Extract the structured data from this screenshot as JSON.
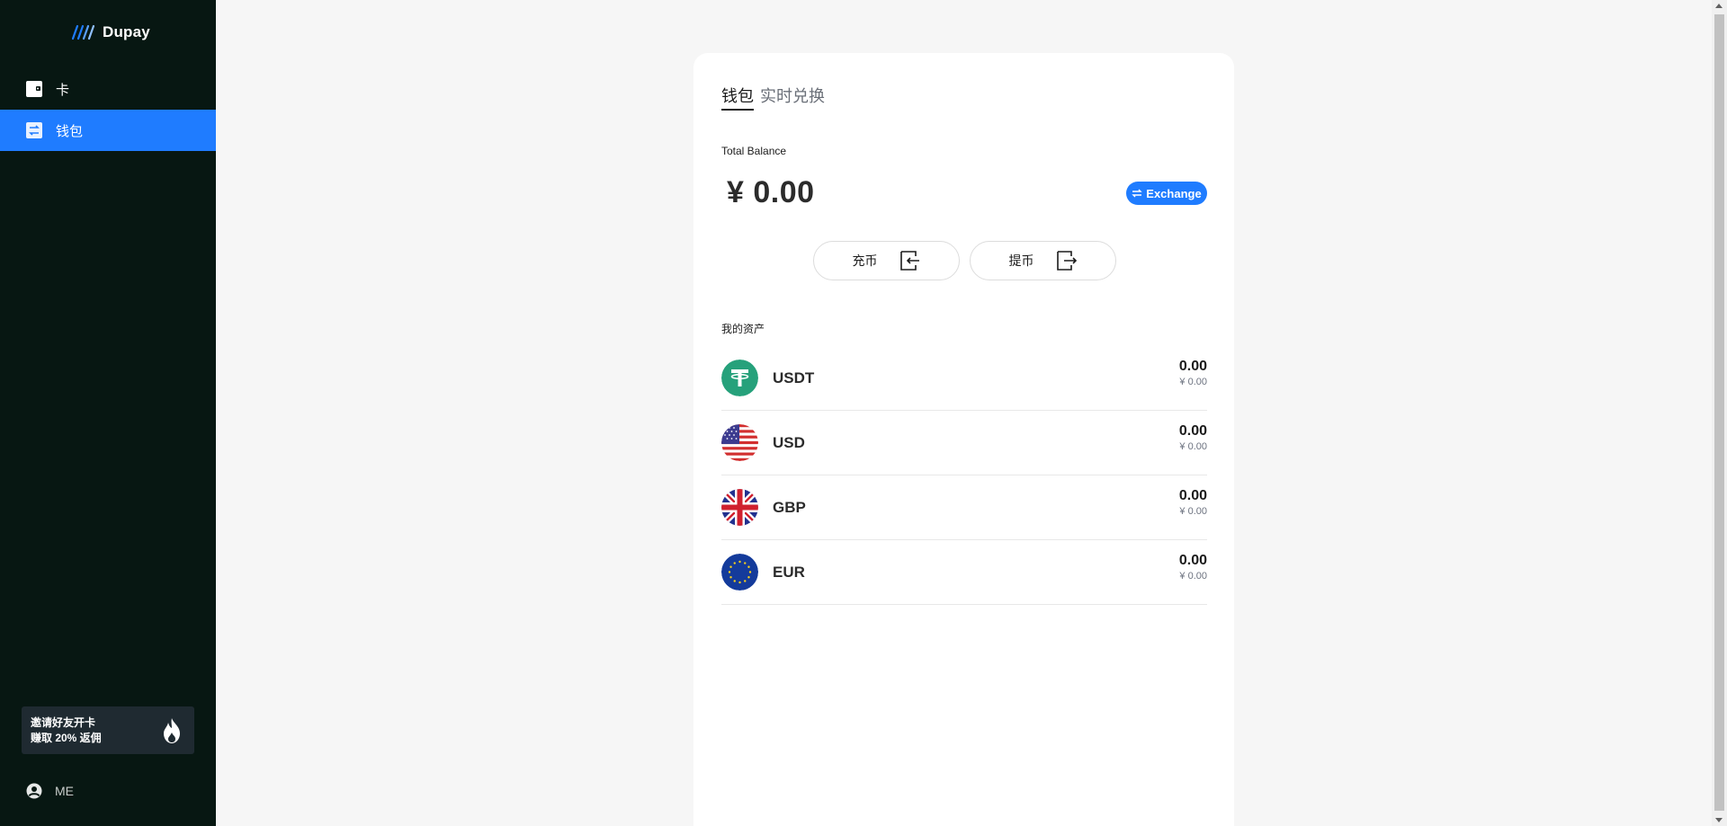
{
  "brand": {
    "name": "Dupay"
  },
  "sidebar": {
    "items": [
      {
        "label": "卡",
        "icon": "wallet-icon",
        "active": false
      },
      {
        "label": "钱包",
        "icon": "transfer-icon",
        "active": true
      }
    ],
    "promo": {
      "line1": "邀请好友开卡",
      "line2": "赚取 20% 返佣",
      "icon": "flame-icon"
    },
    "user": {
      "label": "ME",
      "icon": "user-circle-icon"
    }
  },
  "wallet": {
    "tabs": [
      {
        "label": "钱包",
        "active": true
      },
      {
        "label": "实时兑换",
        "active": false
      }
    ],
    "balance_label": "Total Balance",
    "balance_value": "¥ 0.00",
    "exchange_label": "Exchange",
    "deposit_label": "充币",
    "withdraw_label": "提币",
    "assets_title": "我的资产",
    "assets": [
      {
        "code": "USDT",
        "amount": "0.00",
        "cny": "¥ 0.00",
        "icon": "tether-icon"
      },
      {
        "code": "USD",
        "amount": "0.00",
        "cny": "¥ 0.00",
        "icon": "us-flag-icon"
      },
      {
        "code": "GBP",
        "amount": "0.00",
        "cny": "¥ 0.00",
        "icon": "uk-flag-icon"
      },
      {
        "code": "EUR",
        "amount": "0.00",
        "cny": "¥ 0.00",
        "icon": "eu-flag-icon"
      }
    ]
  },
  "colors": {
    "accent": "#1f7cff",
    "sidebar_bg": "#071712",
    "tether_green": "#26a17b"
  }
}
